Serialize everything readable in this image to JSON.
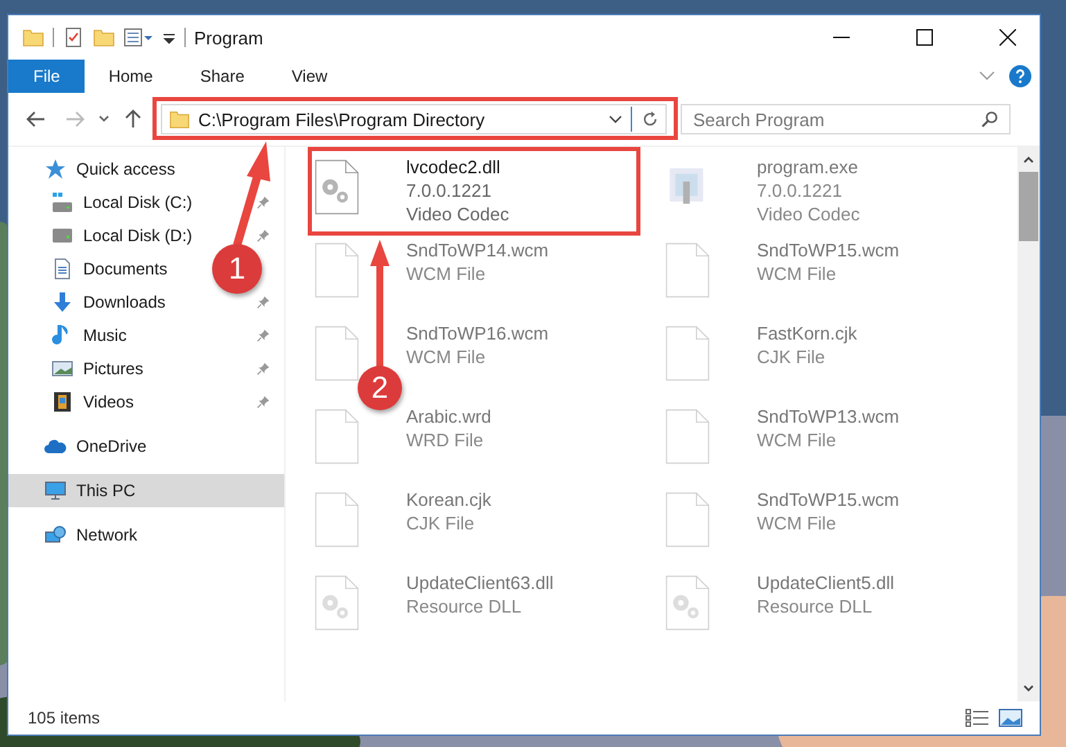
{
  "window": {
    "title": "Program"
  },
  "ribbon": {
    "tabs": [
      {
        "label": "File",
        "selected": true
      },
      {
        "label": "Home",
        "selected": false
      },
      {
        "label": "Share",
        "selected": false
      },
      {
        "label": "View",
        "selected": false
      }
    ]
  },
  "address_bar": {
    "path": "C:\\Program Files\\Program Directory"
  },
  "search": {
    "placeholder": "Search Program"
  },
  "sidebar": {
    "items": [
      {
        "label": "Quick access",
        "kind": "star",
        "selected": false,
        "children": [
          {
            "label": "Local Disk (C:)",
            "kind": "drive-c",
            "selected": false,
            "pinned": true
          },
          {
            "label": "Local Disk (D:)",
            "kind": "drive",
            "selected": false,
            "pinned": true
          },
          {
            "label": "Documents",
            "kind": "documents",
            "selected": false,
            "pinned": false
          },
          {
            "label": "Downloads",
            "kind": "downloads",
            "selected": false,
            "pinned": true
          },
          {
            "label": "Music",
            "kind": "music",
            "selected": false,
            "pinned": true
          },
          {
            "label": "Pictures",
            "kind": "pictures",
            "selected": false,
            "pinned": true
          },
          {
            "label": "Videos",
            "kind": "videos",
            "selected": false,
            "pinned": true
          }
        ]
      },
      {
        "label": "OneDrive",
        "kind": "cloud",
        "selected": false
      },
      {
        "label": "This PC",
        "kind": "pc",
        "selected": true
      },
      {
        "label": "Network",
        "kind": "network",
        "selected": false
      }
    ]
  },
  "files": [
    {
      "name": "lvcodec2.dll",
      "details": [
        "7.0.0.1221",
        "Video Codec"
      ],
      "kind": "gear",
      "blurred": false
    },
    {
      "name": "program.exe",
      "details": [
        "7.0.0.1221",
        "Video Codec"
      ],
      "kind": "exe",
      "blurred": true
    },
    {
      "name": "SndToWP14.wcm",
      "details": [
        "WCM File"
      ],
      "kind": "blank",
      "blurred": true
    },
    {
      "name": "SndToWP15.wcm",
      "details": [
        "WCM File"
      ],
      "kind": "blank",
      "blurred": true
    },
    {
      "name": "SndToWP16.wcm",
      "details": [
        "WCM File"
      ],
      "kind": "blank",
      "blurred": true
    },
    {
      "name": "FastKorn.cjk",
      "details": [
        "CJK File"
      ],
      "kind": "blank",
      "blurred": true
    },
    {
      "name": "Arabic.wrd",
      "details": [
        "WRD File"
      ],
      "kind": "blank",
      "blurred": true
    },
    {
      "name": "SndToWP13.wcm",
      "details": [
        "WCM File"
      ],
      "kind": "blank",
      "blurred": true
    },
    {
      "name": "Korean.cjk",
      "details": [
        "CJK File"
      ],
      "kind": "blank",
      "blurred": true
    },
    {
      "name": "SndToWP15.wcm",
      "details": [
        "WCM File"
      ],
      "kind": "blank",
      "blurred": true
    },
    {
      "name": "UpdateClient63.dll",
      "details": [
        "Resource DLL"
      ],
      "kind": "gear",
      "blurred": true
    },
    {
      "name": "UpdateClient5.dll",
      "details": [
        "Resource DLL"
      ],
      "kind": "gear",
      "blurred": true
    }
  ],
  "status_bar": {
    "item_count": "105 items"
  },
  "annotations": [
    {
      "number": "1"
    },
    {
      "number": "2"
    }
  ]
}
